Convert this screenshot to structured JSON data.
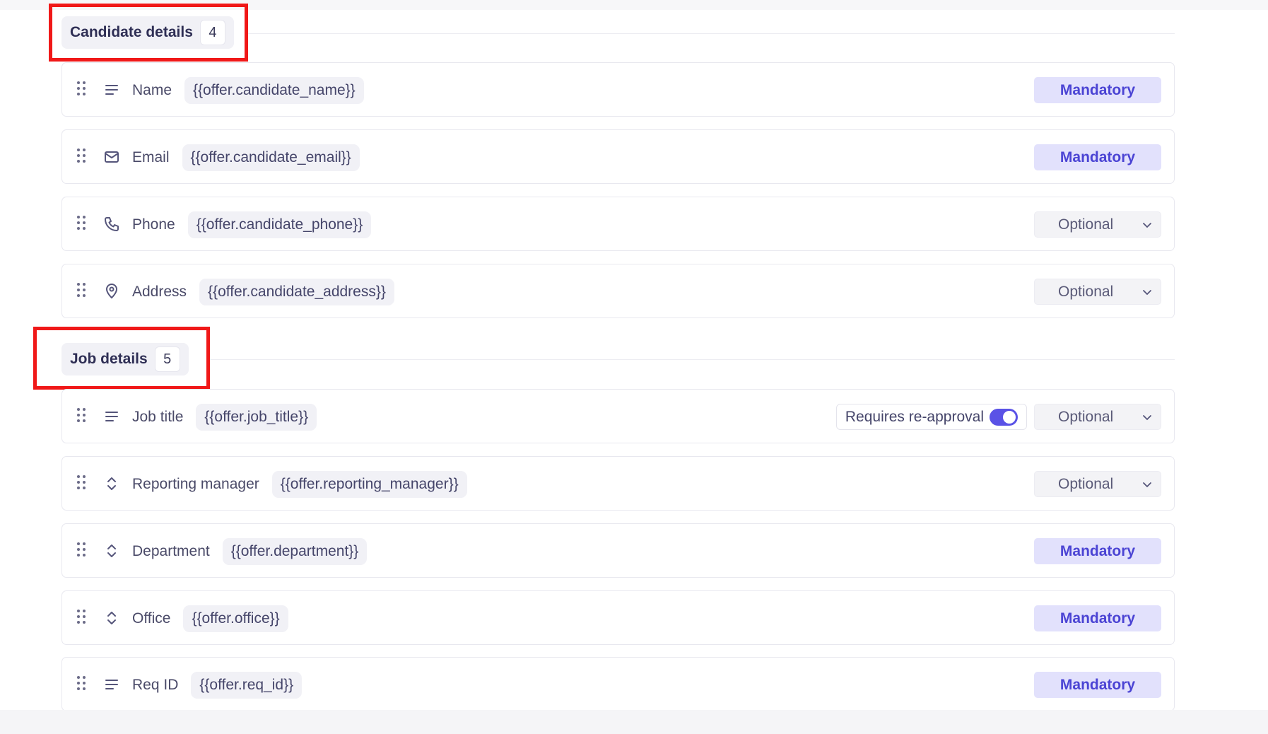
{
  "sections": [
    {
      "title": "Candidate details",
      "count": "4",
      "fields": [
        {
          "label": "Name",
          "token": "{{offer.candidate_name}}",
          "icon": "text-lines-icon",
          "requirement": "Mandatory"
        },
        {
          "label": "Email",
          "token": "{{offer.candidate_email}}",
          "icon": "envelope-icon",
          "requirement": "Mandatory"
        },
        {
          "label": "Phone",
          "token": "{{offer.candidate_phone}}",
          "icon": "phone-icon",
          "requirement": "Optional"
        },
        {
          "label": "Address",
          "token": "{{offer.candidate_address}}",
          "icon": "map-pin-icon",
          "requirement": "Optional"
        }
      ]
    },
    {
      "title": "Job details",
      "count": "5",
      "fields": [
        {
          "label": "Job title",
          "token": "{{offer.job_title}}",
          "icon": "text-lines-icon",
          "requirement": "Optional",
          "reapproval_label": "Requires re-approval",
          "reapproval_enabled": true
        },
        {
          "label": "Reporting manager",
          "token": "{{offer.reporting_manager}}",
          "icon": "chevron-up-down-icon",
          "requirement": "Optional"
        },
        {
          "label": "Department",
          "token": "{{offer.department}}",
          "icon": "chevron-up-down-icon",
          "requirement": "Mandatory"
        },
        {
          "label": "Office",
          "token": "{{offer.office}}",
          "icon": "chevron-up-down-icon",
          "requirement": "Mandatory"
        },
        {
          "label": "Req ID",
          "token": "{{offer.req_id}}",
          "icon": "text-lines-icon",
          "requirement": "Mandatory"
        }
      ]
    }
  ],
  "colors": {
    "accent": "#5a52e6",
    "mandatory_bg": "#e2e1fc",
    "mandatory_text": "#4b44d4",
    "highlight": "#f01818"
  }
}
